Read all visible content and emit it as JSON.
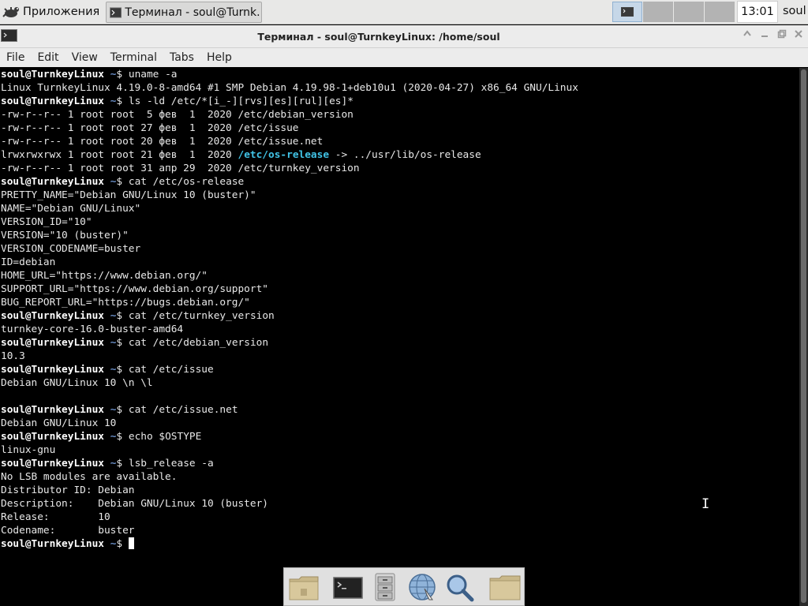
{
  "top_panel": {
    "apps_label": "Приложения",
    "task_label": "Терминал - soul@Turnk...",
    "clock": "13:01",
    "user": "soul"
  },
  "window": {
    "title": "Терминал - soul@TurnkeyLinux: /home/soul"
  },
  "menubar": [
    "File",
    "Edit",
    "View",
    "Terminal",
    "Tabs",
    "Help"
  ],
  "prompt": {
    "user_host": "soul@TurnkeyLinux",
    "path": "~",
    "symbol": "$"
  },
  "terminal": {
    "cmd_uname": "uname -a",
    "out_uname": "Linux TurnkeyLinux 4.19.0-8-amd64 #1 SMP Debian 4.19.98-1+deb10u1 (2020-04-27) x86_64 GNU/Linux",
    "cmd_ls": "ls -ld /etc/*[i_-][rvs][es][rul][es]*",
    "ls_1": "-rw-r--r-- 1 root root  5 фев  1  2020 /etc/debian_version",
    "ls_2": "-rw-r--r-- 1 root root 27 фев  1  2020 /etc/issue",
    "ls_3": "-rw-r--r-- 1 root root 20 фев  1  2020 /etc/issue.net",
    "ls_4_prefix": "lrwxrwxrwx 1 root root 21 фев  1  2020 ",
    "ls_4_link": "/etc/os-release",
    "ls_4_target": " -> ../usr/lib/os-release",
    "ls_5": "-rw-r--r-- 1 root root 31 апр 29  2020 /etc/turnkey_version",
    "cmd_osrel": "cat /etc/os-release",
    "os_1": "PRETTY_NAME=\"Debian GNU/Linux 10 (buster)\"",
    "os_2": "NAME=\"Debian GNU/Linux\"",
    "os_3": "VERSION_ID=\"10\"",
    "os_4": "VERSION=\"10 (buster)\"",
    "os_5": "VERSION_CODENAME=buster",
    "os_6": "ID=debian",
    "os_7": "HOME_URL=\"https://www.debian.org/\"",
    "os_8": "SUPPORT_URL=\"https://www.debian.org/support\"",
    "os_9": "BUG_REPORT_URL=\"https://bugs.debian.org/\"",
    "cmd_tk": "cat /etc/turnkey_version",
    "out_tk": "turnkey-core-16.0-buster-amd64",
    "cmd_deb": "cat /etc/debian_version",
    "out_deb": "10.3",
    "cmd_issue": "cat /etc/issue",
    "out_issue": "Debian GNU/Linux 10 \\n \\l",
    "cmd_issuenet": "cat /etc/issue.net",
    "out_issuenet": "Debian GNU/Linux 10",
    "cmd_echo": "echo $OSTYPE",
    "out_echo": "linux-gnu",
    "cmd_lsb": "lsb_release -a",
    "lsb_1": "No LSB modules are available.",
    "lsb_2": "Distributor ID: Debian",
    "lsb_3": "Description:    Debian GNU/Linux 10 (buster)",
    "lsb_4": "Release:        10",
    "lsb_5": "Codename:       buster"
  },
  "colors": {
    "prompt_user": "#ffffff",
    "prompt_path": "#6a8fc8",
    "symlink": "#41c3e6",
    "background": "#000000"
  },
  "dock": [
    "folder-icon",
    "terminal-icon",
    "file-cabinet-icon",
    "web-browser-icon",
    "search-icon",
    "folder-icon"
  ]
}
